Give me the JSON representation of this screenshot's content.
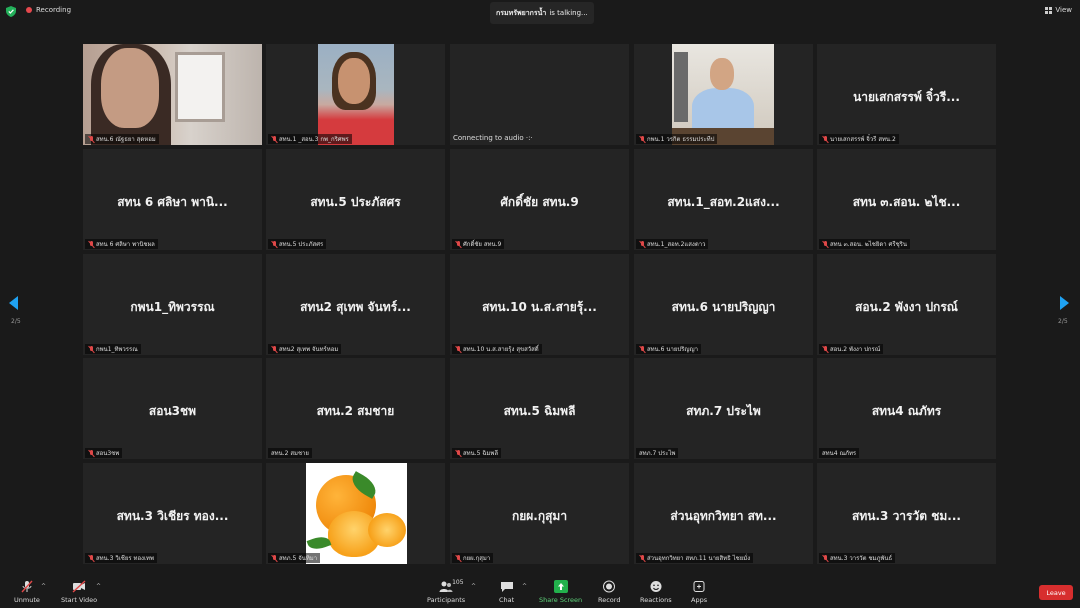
{
  "topbar": {
    "recording_label": "Recording",
    "talking_name": "กรมทรัพยากรน้ำ",
    "talking_suffix": "is talking...",
    "view_label": "View"
  },
  "pager": {
    "page_left": "2/5",
    "page_right": "2/5"
  },
  "tiles": [
    {
      "center": "",
      "label": "สทน.6 ณัฐธยา สุดหอม",
      "muted": true
    },
    {
      "center": "",
      "label": "สทน.1 _สอน.3 กพ_กริศพร",
      "muted": true
    },
    {
      "center": "",
      "label": "Connecting to audio",
      "muted": false
    },
    {
      "center": "",
      "label": "กพน.1 วรกิต ธรรมประทีป",
      "muted": true
    },
    {
      "center": "นายเสกสรรพ์ จิ๋วรี...",
      "label": "นายเสกสรรพ์ จิ๋วรี สทน.2",
      "muted": true
    },
    {
      "center": "สทน 6 ศลิษา พานิ...",
      "label": "สทน 6 ศลิษา พานิชผล",
      "muted": true
    },
    {
      "center": "สทน.5 ประภัสศร",
      "label": "สทน.5 ประภัสศร",
      "muted": true
    },
    {
      "center": "ศักดิ์ชัย สทน.9",
      "label": "ศักดิ์ชัย สทน.9",
      "muted": true
    },
    {
      "center": "สทน.1_สอท.2แสง...",
      "label": "สทน.1_สอท.2แสงดาว",
      "muted": true
    },
    {
      "center": "สทน ๓.สอน. ๒ไช...",
      "label": "สทน ๓.สอน. ๒ไชยิดา ศรีชุริน",
      "muted": true
    },
    {
      "center": "กพน1_ทิพวรรณ",
      "label": "กพน1_ทิพวรรณ",
      "muted": true
    },
    {
      "center": "สทน2 สุเทพ จันทร์...",
      "label": "สทน2 สุเทพ จันทร์หอม",
      "muted": true
    },
    {
      "center": "สทน.10 น.ส.สายรุ้...",
      "label": "สทน.10 น.ส.สายรุ้ง สุขสวัสดิ์",
      "muted": true
    },
    {
      "center": "สทน.6 นายปริญญา",
      "label": "สทน.6 นายปริญญา",
      "muted": true
    },
    {
      "center": "สอน.2 พังงา ปกรณ์",
      "label": "สอน.2 พังงา ปกรณ์",
      "muted": true
    },
    {
      "center": "สอน3ชพ",
      "label": "สอน3ชพ",
      "muted": true
    },
    {
      "center": "สทน.2 สมชาย",
      "label": "สทน.2 สมชาย",
      "muted": false
    },
    {
      "center": "สทน.5 ฉิมพลี",
      "label": "สทน.5 ฉิมพลี",
      "muted": true
    },
    {
      "center": "สทภ.7 ประไพ",
      "label": "สทภ.7 ประไพ",
      "muted": false
    },
    {
      "center": "สทน4 ณภัทร",
      "label": "สทน4 ณภัทร",
      "muted": false
    },
    {
      "center": "สทน.3 วิเชียร ทอง...",
      "label": "สทน.3 วิเชียร ทองเทพ",
      "muted": true
    },
    {
      "center": "",
      "label": "สทภ.5 จันทิมา",
      "muted": true
    },
    {
      "center": "กยผ.กุสุมา",
      "label": "กยผ.กุสุมา",
      "muted": true
    },
    {
      "center": "ส่วนอุทกวิทยา สท...",
      "label": "ส่วนอุทกวิทยา สทภ.11 นายสิทธิ ไชยมั่ง",
      "muted": true
    },
    {
      "center": "สทน.3 วารวัต ชม...",
      "label": "สทน.3 วารวัต ชมภูพันธ์",
      "muted": true
    }
  ],
  "toolbar": {
    "unmute": "Unmute",
    "start_video": "Start Video",
    "participants": "Participants",
    "participants_count": "105",
    "chat": "Chat",
    "share_screen": "Share Screen",
    "record": "Record",
    "reactions": "Reactions",
    "apps": "Apps",
    "leave": "Leave"
  },
  "colors": {
    "accent": "#1fa2f2",
    "share": "#22b14c",
    "leave": "#d72e2e",
    "recording": "#e5484d"
  }
}
